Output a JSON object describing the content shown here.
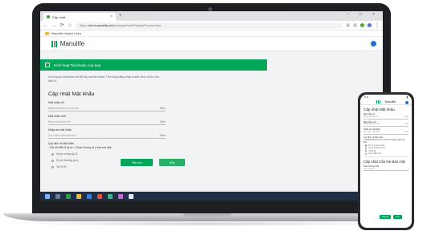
{
  "browser": {
    "tab_title": "Cập nhật",
    "new_tab": "+",
    "window_controls": "–  □  ×",
    "url_prefix": "https://",
    "url_domain": "mlr-vn.azurefly.com",
    "url_path": "/landing/qr/vuln/Reg/api/Prompt=New",
    "bookmark": "Manulife Helpful Links"
  },
  "app": {
    "brand": "Manulife",
    "banner_title": "Kích hoạt Tài khoản của bạn",
    "intro_line1": "Vui lòng tạo mật khẩu mới để bảo mật tài khoản. Tính năng đăng nhập nhanh được hỗ trợ cho",
    "intro_line2": "thiết bị.",
    "section_title": "Cập nhật Mật khẩu",
    "fields": [
      {
        "label": "Mật khẩu cũ",
        "placeholder": "Nhập mật khẩu cũ của bạn",
        "toggle": "Hiện"
      },
      {
        "label": "Mật khẩu mới",
        "placeholder": "Nhập mật khẩu mới",
        "toggle": "Hiện"
      },
      {
        "label": "Nhập lại mật khẩu",
        "placeholder": "Xác nhận mật khẩu mới",
        "toggle": "Hiện"
      }
    ],
    "rules_title": "Quy định về Mật khẩu",
    "rules_sub": "- Dài tối thiểu 8 ký tự • Chứa 3 trong số 4 loại sau đây:",
    "rules": [
      "Ký tự in hoa (A-Z)",
      "Ký tự thường (a-z)",
      "Số (0-9)"
    ],
    "button_primary": "Tiếp tục",
    "button_secondary": "Hủy"
  },
  "taskbar": {
    "time": "4:03 PM",
    "date": "8/5/2020"
  },
  "phone": {
    "time": "9:41",
    "brand": "Manulife",
    "title": "Cập nhật Mật khẩu",
    "fields": [
      {
        "label": "Mật khẩu cũ",
        "placeholder": "Nhập mật khẩu cũ",
        "toggle": "Hiện"
      },
      {
        "label": "Mật khẩu mới",
        "placeholder": "Nhập mật khẩu mới",
        "toggle": "Hiện"
      },
      {
        "label": "Nhập lại mật khẩu",
        "placeholder": "Xác nhận mật khẩu",
        "toggle": "Hiện"
      }
    ],
    "rules_title": "Quy định về Mật khẩu",
    "rules_sub": "- Dài tối thiểu 8 ký tự • Chứa 3 trong 4 loại sau đây:",
    "rules": [
      "Ký tự in hoa (A-Z)",
      "Ký tự thường (a-z)",
      "Số (0-9)",
      "Ký tự đặc biệt"
    ],
    "title2": "Cập nhật Câu hỏi Bảo mật",
    "q_label": "Câu hỏi bảo mật",
    "q_placeholder": "Chọn câu hỏi",
    "button_primary": "Tiếp tục",
    "button_secondary": "Hủy"
  },
  "colors": {
    "accent": "#00a758",
    "taskbar": "#1f2f48",
    "brand_blue": "#1f6fd6"
  }
}
